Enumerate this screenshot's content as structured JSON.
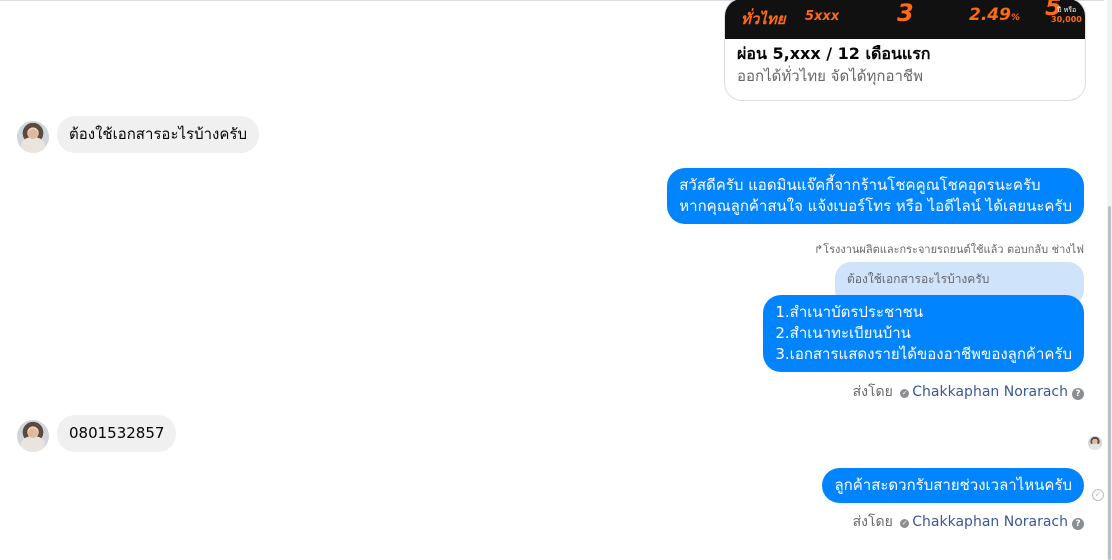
{
  "product_card": {
    "banner": {
      "region": "ทั่วไทย",
      "price": "5xxx",
      "approve_num": "3",
      "rate": "2.49",
      "rate_unit": "%",
      "years": "5",
      "or": "ปี หรือ",
      "km": "30,000"
    },
    "title": "ผ่อน 5,xxx / 12 เดือนแรก",
    "subtitle": "ออกได้ทั่วไทย จัดได้ทุกอาชีพ"
  },
  "messages": {
    "incoming_1": "ต้องใช้เอกสารอะไรบ้างครับ",
    "outgoing_1": [
      "สวัสดีครับ แอดมินแจ๊คกี้จากร้านโชคคูณโชคอุดรนะครับ",
      "หากคุณลูกค้าสนใจ แจ้งเบอร์โทร หรือ ไอดีไลน์ ได้เลยนะครับ"
    ],
    "reply_label": "โรงงานผลิตและกระจายรถยนต์ใช้แล้ว ตอบกลับ ช่างไฟ",
    "reply_quote": "ต้องใช้เอกสารอะไรบ้างครับ",
    "outgoing_2": [
      "1.สำเนาบัตรประชาชน",
      "2.สำเนาทะเบียนบ้าน",
      "3.เอกสารแสดงรายได้ของอาชีพของลูกค้าครับ"
    ],
    "incoming_2": "0801532857",
    "outgoing_3": "ลูกค้าสะดวกรับสายช่วงเวลาไหนครับ"
  },
  "sent_by": {
    "prefix": "ส่งโดย",
    "name": "Chakkaphan Norarach",
    "help": "?"
  },
  "icons": {
    "avatar": "user-avatar",
    "verified": "verified-icon",
    "help": "help-icon",
    "reply": "reply-arrow-icon",
    "seen": "seen-check-icon"
  },
  "colors": {
    "outgoing_bubble": "#0084ff",
    "incoming_bubble": "#f0f0f0",
    "quote_bubble": "#cfe3fb",
    "name_link": "#385898",
    "banner_accent": "#ff6a13"
  }
}
